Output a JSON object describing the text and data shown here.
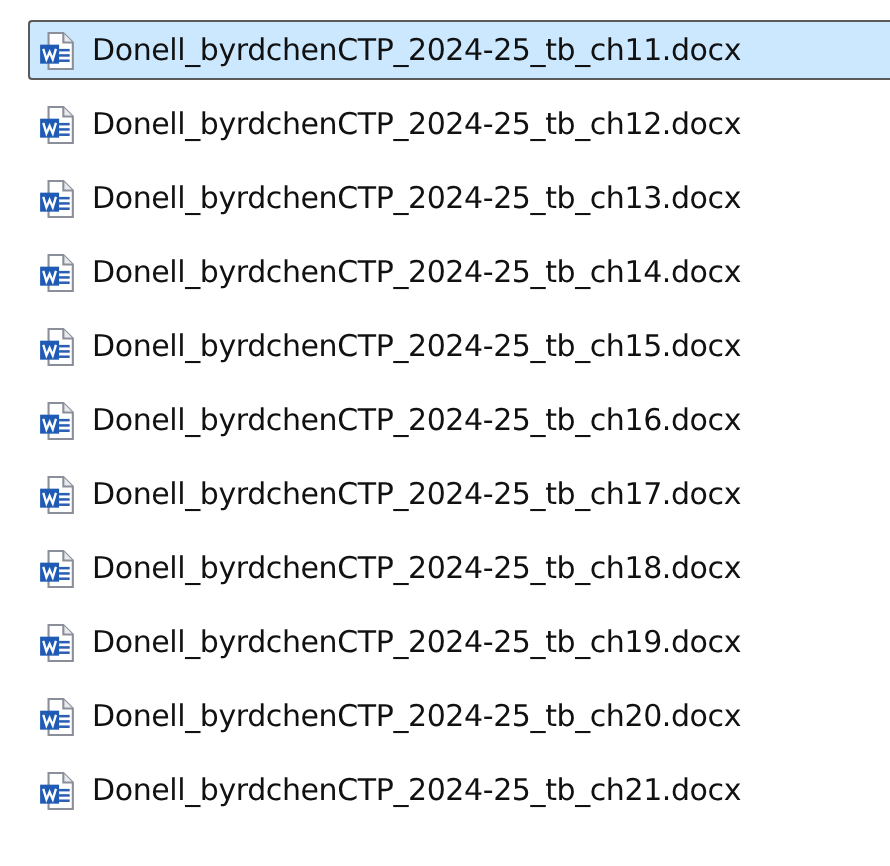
{
  "files": [
    {
      "name": "Donell_byrdchenCTP_2024-25_tb_ch11.docx",
      "selected": true
    },
    {
      "name": "Donell_byrdchenCTP_2024-25_tb_ch12.docx",
      "selected": false
    },
    {
      "name": "Donell_byrdchenCTP_2024-25_tb_ch13.docx",
      "selected": false
    },
    {
      "name": "Donell_byrdchenCTP_2024-25_tb_ch14.docx",
      "selected": false
    },
    {
      "name": "Donell_byrdchenCTP_2024-25_tb_ch15.docx",
      "selected": false
    },
    {
      "name": "Donell_byrdchenCTP_2024-25_tb_ch16.docx",
      "selected": false
    },
    {
      "name": "Donell_byrdchenCTP_2024-25_tb_ch17.docx",
      "selected": false
    },
    {
      "name": "Donell_byrdchenCTP_2024-25_tb_ch18.docx",
      "selected": false
    },
    {
      "name": "Donell_byrdchenCTP_2024-25_tb_ch19.docx",
      "selected": false
    },
    {
      "name": "Donell_byrdchenCTP_2024-25_tb_ch20.docx",
      "selected": false
    },
    {
      "name": "Donell_byrdchenCTP_2024-25_tb_ch21.docx",
      "selected": false
    }
  ]
}
